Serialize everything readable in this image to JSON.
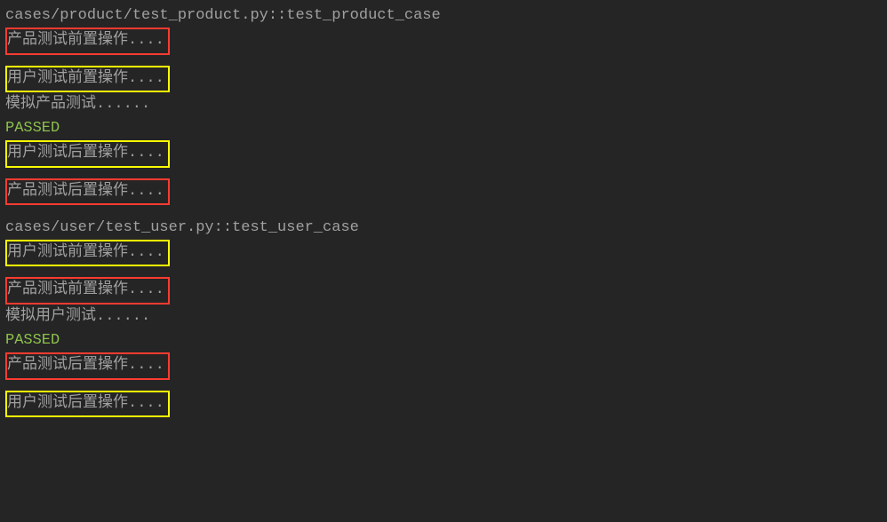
{
  "block1": {
    "path": "cases/product/test_product.py::test_product_case",
    "line1": "产品测试前置操作....",
    "line2": "用户测试前置操作....",
    "line3": "模拟产品测试......",
    "passed": "PASSED",
    "line4": "用户测试后置操作....",
    "line5": "产品测试后置操作...."
  },
  "block2": {
    "path": "cases/user/test_user.py::test_user_case",
    "line1": "用户测试前置操作....",
    "line2": "产品测试前置操作....",
    "line3": "模拟用户测试......",
    "passed": "PASSED",
    "line4": "产品测试后置操作....",
    "line5": "用户测试后置操作...."
  }
}
